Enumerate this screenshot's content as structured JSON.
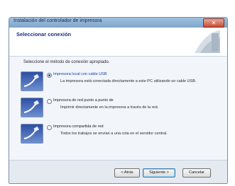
{
  "window": {
    "title": "Instalación del controlador de impresora",
    "close_symbol": "✕"
  },
  "header": {
    "title": "Seleccionar conexión",
    "decoration_icon": "printer-graphic"
  },
  "main": {
    "intro": "Seleccione el método de conexión apropiado.",
    "options": [
      {
        "title": "Impresora local con cable USB",
        "description": "La impresora está conectada directamente a este PC utilizando un cable USB.",
        "selected": true,
        "icon": "usb-cable-icon"
      },
      {
        "title": "Impresora de red punto a punto de",
        "description": "Imprimir directamente en la impresora a través de la red.",
        "selected": false,
        "icon": "network-cable-icon"
      },
      {
        "title": "Impresora compartida de red",
        "description": "Todos los trabajos se envían a una cola en el servidor central.",
        "selected": false,
        "icon": "shared-network-cable-icon"
      }
    ]
  },
  "footer": {
    "back_label": "< Atrás",
    "next_label": "Siguiente >",
    "cancel_label": "Cancelar"
  },
  "colors": {
    "header_title": "#1c2f86",
    "icon_blue": "#2d4fa3",
    "close_red": "#c74b34"
  }
}
